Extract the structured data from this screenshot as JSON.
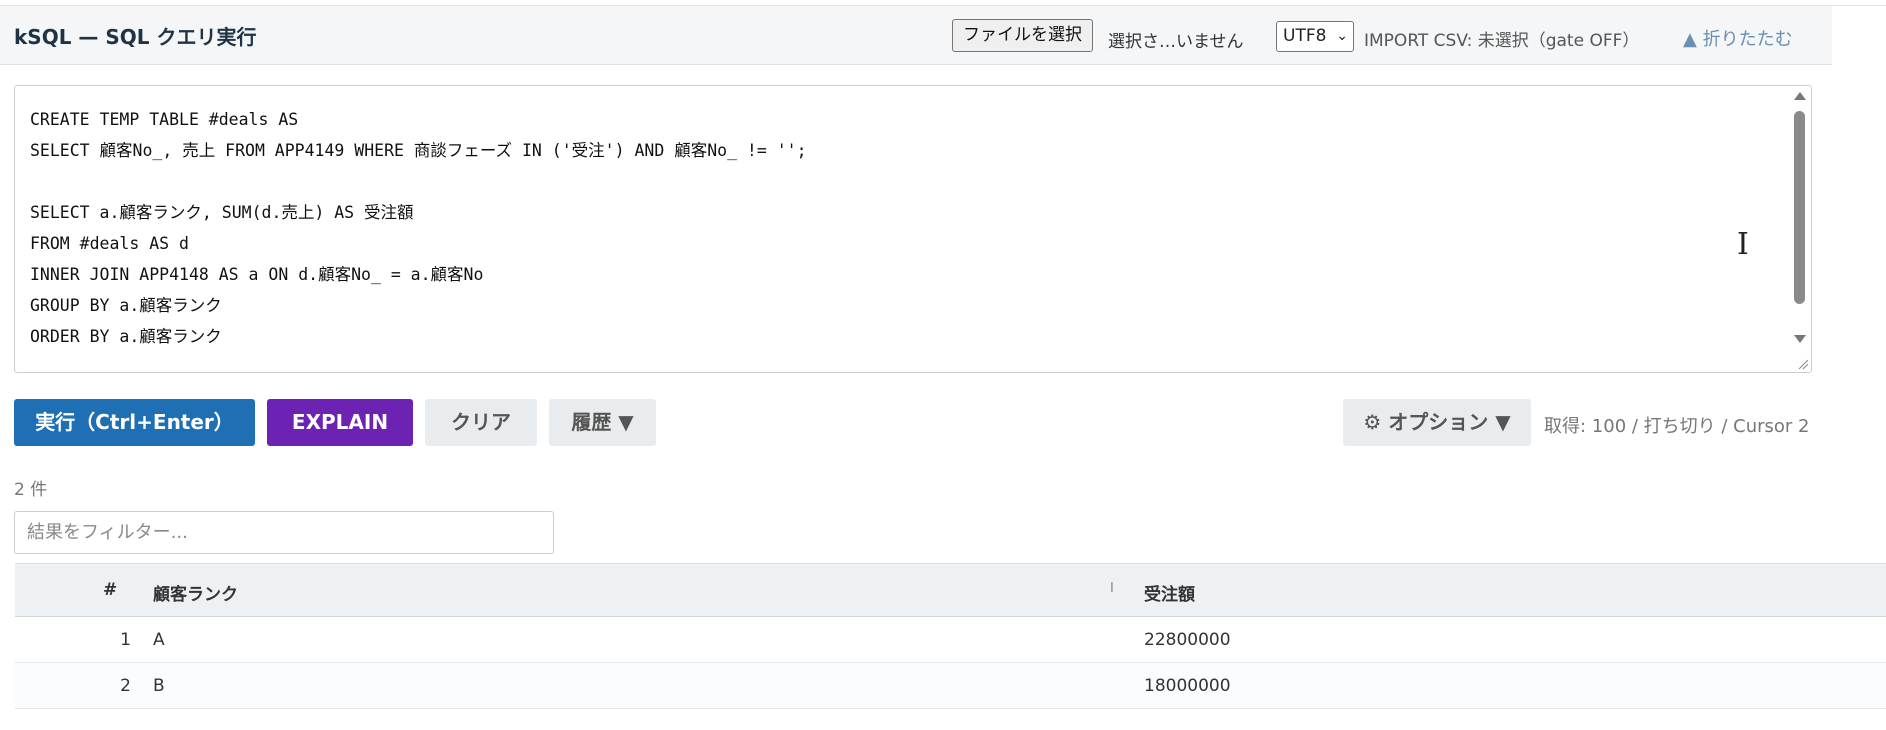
{
  "header": {
    "title": "kSQL — SQL クエリ実行",
    "file_button": "ファイルを選択",
    "file_status": "選択さ…いません",
    "encoding": "UTF8",
    "import_status": "IMPORT CSV: 未選択（gate OFF）",
    "collapse": "▲ 折りたたむ"
  },
  "editor": {
    "sql": "CREATE TEMP TABLE #deals AS\nSELECT 顧客No_, 売上 FROM APP4149 WHERE 商談フェーズ IN ('受注') AND 顧客No_ != '';\n\nSELECT a.顧客ランク, SUM(d.売上) AS 受注額\nFROM #deals AS d\nINNER JOIN APP4148 AS a ON d.顧客No_ = a.顧客No\nGROUP BY a.顧客ランク\nORDER BY a.顧客ランク"
  },
  "toolbar": {
    "run": "実行（Ctrl+Enter）",
    "explain": "EXPLAIN",
    "clear": "クリア",
    "history": "履歴 ▼",
    "options": "⚙ オプション ▼",
    "fetch_info": "取得: 100 / 打ち切り / Cursor 2"
  },
  "results": {
    "count": "2 件",
    "filter_placeholder": "結果をフィルター...",
    "columns": [
      "#",
      "顧客ランク",
      "受注額"
    ],
    "rows": [
      {
        "index": "1",
        "rank": "A",
        "amount": "22800000"
      },
      {
        "index": "2",
        "rank": "B",
        "amount": "18000000"
      }
    ]
  }
}
